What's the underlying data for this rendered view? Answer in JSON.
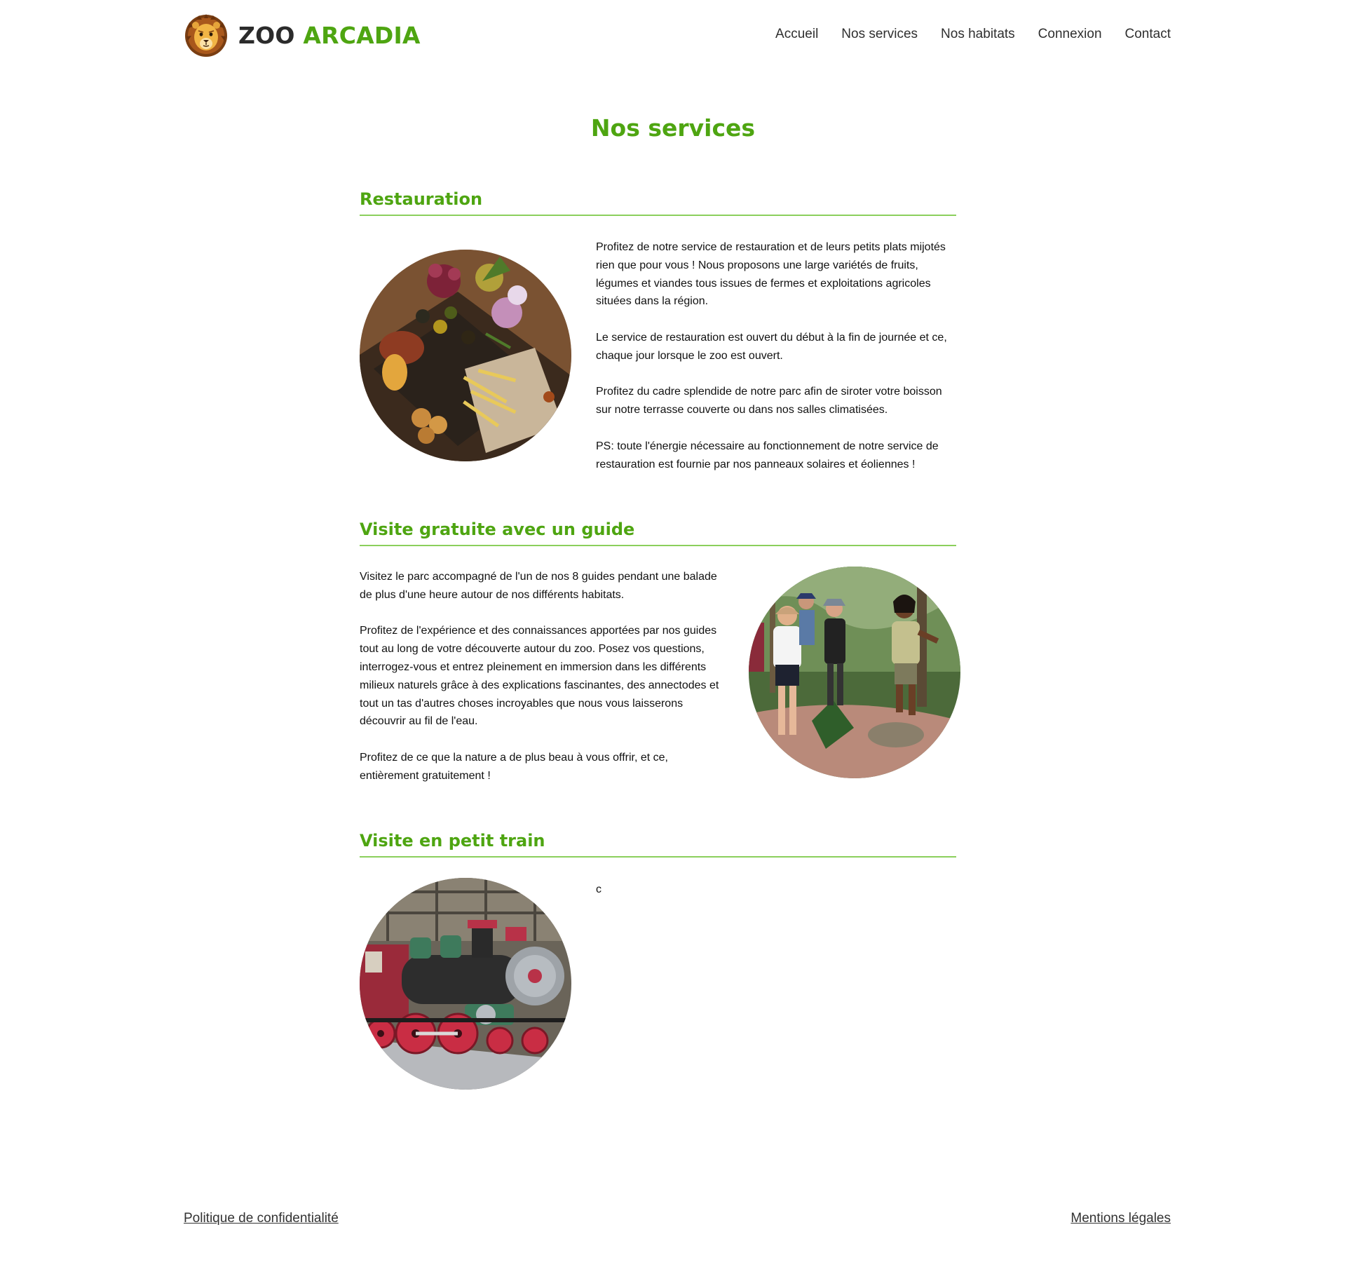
{
  "brand": {
    "name_part1": "ZOO",
    "name_part2": "ARCADIA",
    "logo_icon": "lion-head-icon"
  },
  "nav": {
    "items": [
      {
        "label": "Accueil"
      },
      {
        "label": "Nos services"
      },
      {
        "label": "Nos habitats"
      },
      {
        "label": "Connexion"
      },
      {
        "label": "Contact"
      }
    ]
  },
  "main": {
    "title": "Nos services",
    "sections": [
      {
        "title": "Restauration",
        "image": "food-platter-photo",
        "paragraphs": [
          "Profitez de notre service de restauration et de leurs petits plats mijotés rien que pour vous ! Nous proposons une large variétés de fruits, légumes et viandes tous issues de fermes et exploitations agricoles situées dans la région.",
          "Le service de restauration est ouvert du début à la fin de journée et ce, chaque jour lorsque le zoo est ouvert.",
          "Profitez du cadre splendide de notre parc afin de siroter votre boisson sur notre terrasse couverte ou dans nos salles climatisées.",
          "PS: toute l'énergie nécessaire au fonctionnement de notre service de restauration est fournie par nos panneaux solaires et éoliennes !"
        ]
      },
      {
        "title": "Visite gratuite avec un guide",
        "image": "guided-tour-photo",
        "paragraphs": [
          "Visitez le parc accompagné de l'un de nos 8 guides pendant une balade de plus d'une heure autour de nos différents habitats.",
          "Profitez de l'expérience et des connaissances apportées par nos guides tout au long de votre découverte autour du zoo. Posez vos questions, interrogez-vous et entrez pleinement en immersion dans les différents milieux naturels grâce à des explications fascinantes, des annectodes et tout un tas d'autres choses incroyables que nous vous laisserons découvrir au fil de l'eau.",
          "Profitez de ce que la nature a de plus beau à vous offrir, et ce, entièrement gratuitement !"
        ]
      },
      {
        "title": "Visite en petit train",
        "image": "steam-train-photo",
        "paragraphs": [
          "c"
        ]
      }
    ]
  },
  "footer": {
    "privacy_label": "Politique de confidentialité",
    "legal_label": "Mentions légales"
  },
  "colors": {
    "accent": "#4ea511",
    "rule": "#8bcf5c",
    "text": "#111111",
    "nav_text": "#2f2f2f"
  }
}
